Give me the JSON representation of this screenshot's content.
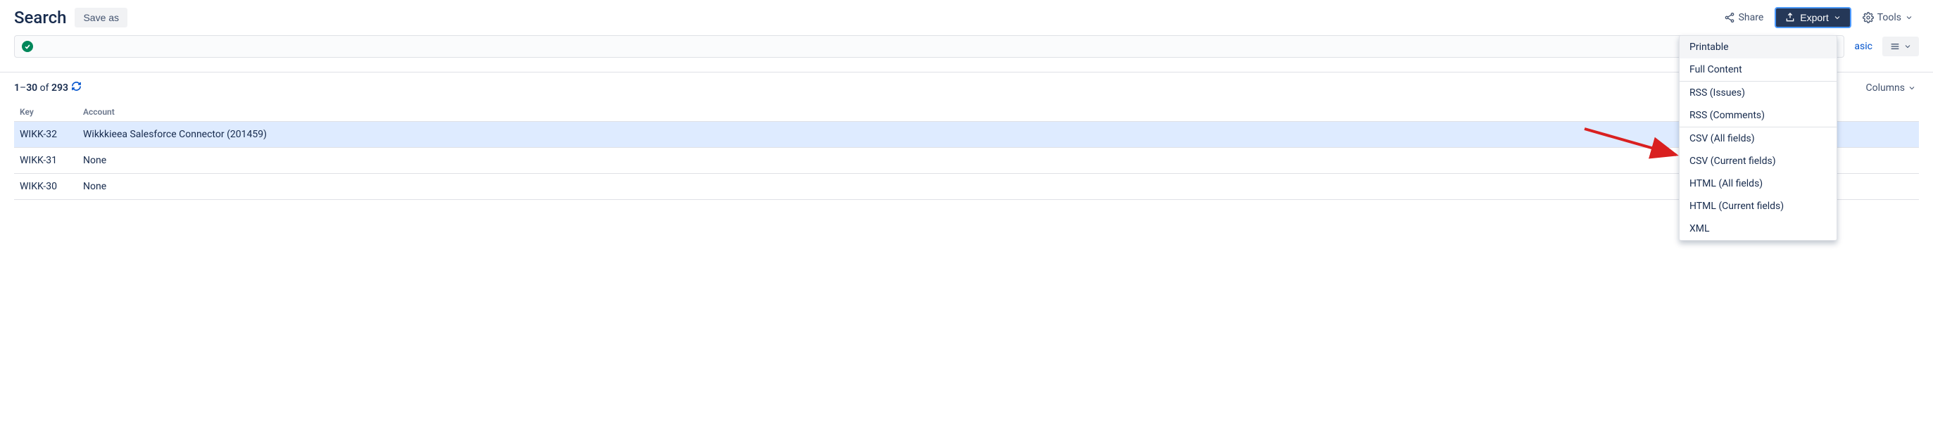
{
  "header": {
    "title": "Search",
    "saveAs": "Save as",
    "share": "Share",
    "export": "Export",
    "tools": "Tools",
    "basic": "asic"
  },
  "results": {
    "rangeStart": "1",
    "rangeEnd": "30",
    "ofText": " of ",
    "total": "293",
    "columnsLabel": "Columns"
  },
  "table": {
    "headers": {
      "key": "Key",
      "account": "Account"
    },
    "rows": [
      {
        "key": "WIKK-32",
        "account": "Wikkkieea Salesforce Connector (201459)",
        "highlighted": true
      },
      {
        "key": "WIKK-31",
        "account": "None",
        "highlighted": false
      },
      {
        "key": "WIKK-30",
        "account": "None",
        "highlighted": false
      }
    ]
  },
  "exportMenu": {
    "groups": [
      [
        "Printable",
        "Full Content"
      ],
      [
        "RSS (Issues)",
        "RSS (Comments)"
      ],
      [
        "CSV (All fields)",
        "CSV (Current fields)",
        "HTML (All fields)",
        "HTML (Current fields)",
        "XML"
      ]
    ],
    "hovered": "Printable",
    "target": "CSV (Current fields)"
  }
}
